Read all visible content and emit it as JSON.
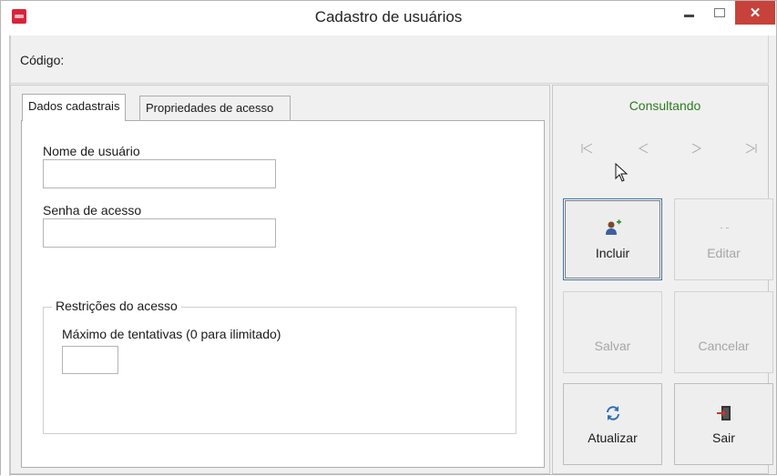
{
  "window": {
    "title": "Cadastro de usuários"
  },
  "titlebar_buttons": {
    "close": "✕"
  },
  "header": {
    "code_label": "Código:"
  },
  "tabs": [
    {
      "label": "Dados cadastrais",
      "active": true
    },
    {
      "label": "Propriedades de acesso",
      "active": false
    }
  ],
  "form": {
    "username_label": "Nome de usuário",
    "username_value": "",
    "password_label": "Senha de acesso",
    "password_value": "",
    "restrictions_legend": "Restrições do acesso",
    "max_attempts_label": "Máximo de tentativas (0 para ilimitado)",
    "max_attempts_value": ""
  },
  "side": {
    "status": "Consultando",
    "status_color": "#2c7a1e",
    "nav_icons": [
      "first-record-icon",
      "previous-record-icon",
      "next-record-icon",
      "last-record-icon"
    ]
  },
  "actions": {
    "include": "Incluir",
    "edit": "Editar",
    "save": "Salvar",
    "cancel": "Cancelar",
    "refresh": "Atualizar",
    "exit": "Sair"
  }
}
